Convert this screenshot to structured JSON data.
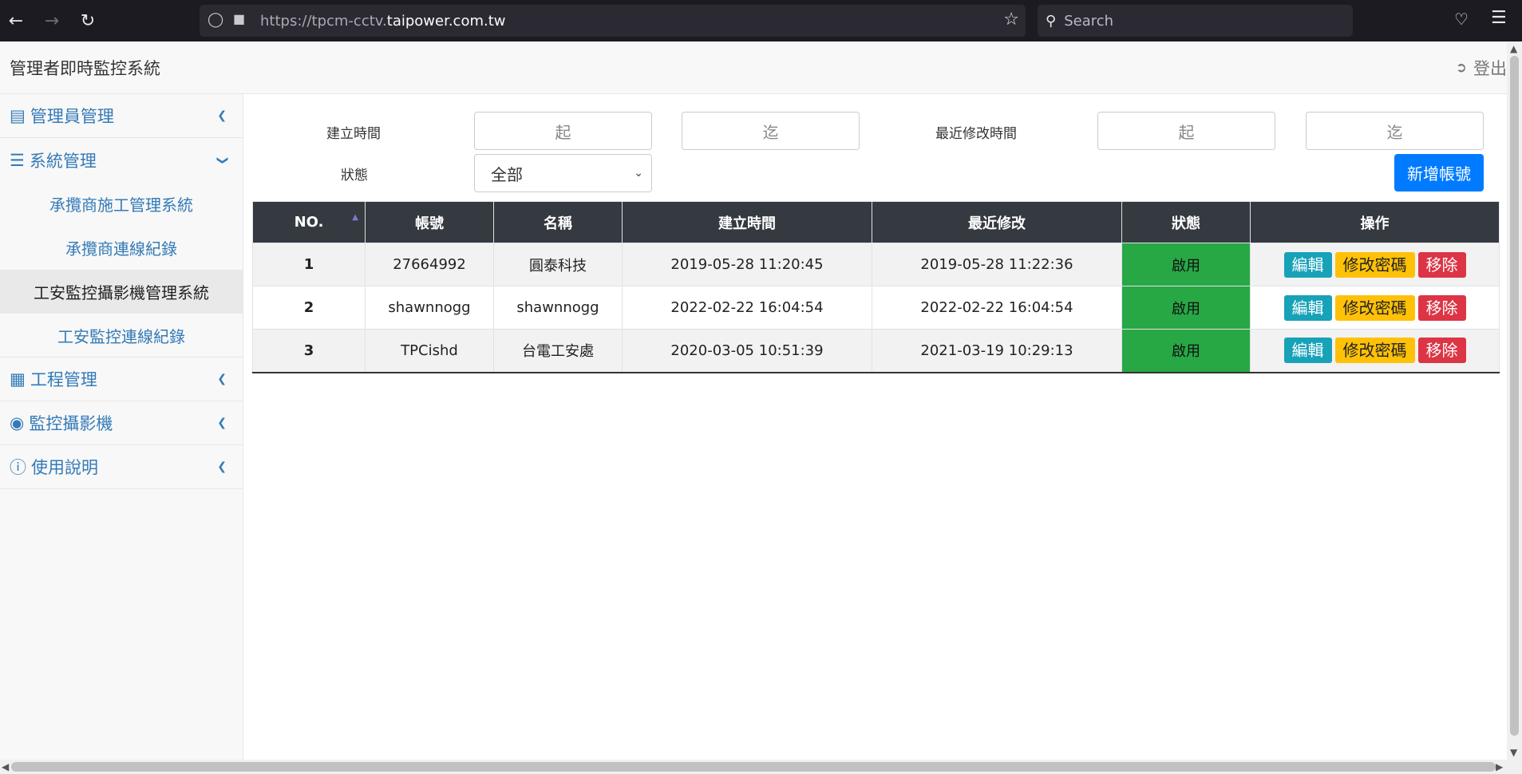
{
  "browser": {
    "url_prefix": "https://tpcm-cctv.",
    "url_domain": "taipower.com.tw",
    "search_placeholder": "Search"
  },
  "header": {
    "title": "管理者即時監控系統",
    "logout": "登出"
  },
  "sidebar": {
    "items": [
      {
        "label": "管理員管理",
        "icon": "bar-chart-icon"
      },
      {
        "label": "系統管理",
        "icon": "list-icon"
      },
      {
        "label": "工程管理",
        "icon": "building-icon"
      },
      {
        "label": "監控攝影機",
        "icon": "camera-icon"
      },
      {
        "label": "使用說明",
        "icon": "info-icon"
      }
    ],
    "sub_items": [
      "承攬商施工管理系統",
      "承攬商連線紀錄",
      "工安監控攝影機管理系統",
      "工安監控連線紀錄"
    ]
  },
  "filters": {
    "created_label": "建立時間",
    "modified_label": "最近修改時間",
    "status_label": "狀態",
    "from_placeholder": "起",
    "to_placeholder": "迄",
    "status_value": "全部",
    "add_button": "新增帳號"
  },
  "table": {
    "headers": [
      "NO.",
      "帳號",
      "名稱",
      "建立時間",
      "最近修改",
      "狀態",
      "操作"
    ],
    "rows": [
      {
        "no": "1",
        "account": "27664992",
        "name": "圓泰科技",
        "created": "2019-05-28 11:20:45",
        "modified": "2019-05-28 11:22:36",
        "status": "啟用"
      },
      {
        "no": "2",
        "account": "shawnnogg",
        "name": "shawnnogg",
        "created": "2022-02-22 16:04:54",
        "modified": "2022-02-22 16:04:54",
        "status": "啟用"
      },
      {
        "no": "3",
        "account": "TPCishd",
        "name": "台電工安處",
        "created": "2020-03-05 10:51:39",
        "modified": "2021-03-19 10:29:13",
        "status": "啟用"
      }
    ],
    "actions": {
      "edit": "編輯",
      "password": "修改密碼",
      "delete": "移除"
    }
  },
  "colors": {
    "primary": "#007bff",
    "success": "#28a745",
    "info": "#17a2b8",
    "warning": "#ffc107",
    "danger": "#dc3545",
    "table_header": "#343a40",
    "link": "#337ab7"
  }
}
